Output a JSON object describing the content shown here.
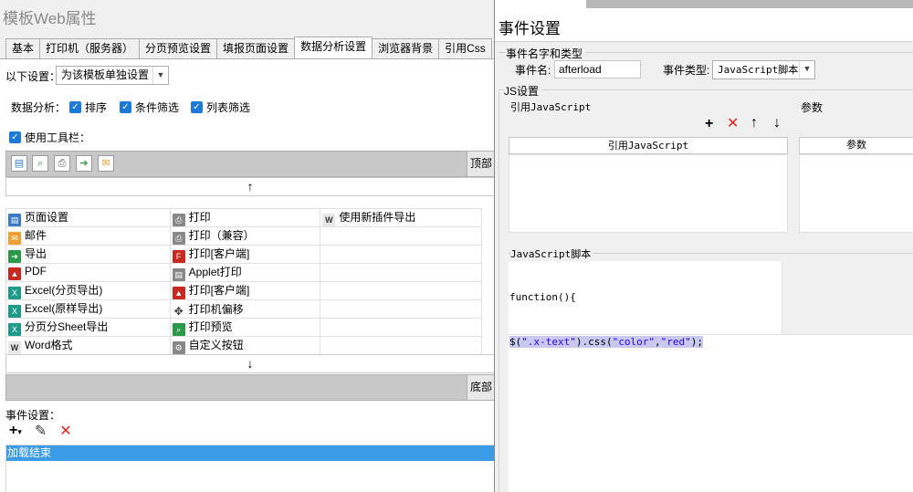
{
  "main": {
    "title": "模板Web属性",
    "tabs": [
      "基本",
      "打印机（服务器）",
      "分页预览设置",
      "填报页面设置",
      "数据分析设置",
      "浏览器背景",
      "引用Css"
    ],
    "active_tab": 4,
    "settings_label": "以下设置：",
    "settings_select": "为该模板单独设置",
    "data_analysis_label": "数据分析：",
    "checkbox_sort": "排序",
    "checkbox_filter": "条件筛选",
    "checkbox_col_filter": "列表筛选",
    "use_toolbar": "使用工具栏：",
    "top_label": "顶部",
    "bottom_label": "底部",
    "up_arrow": "↑",
    "down_arrow": "↓",
    "grid": [
      [
        {
          "icon": "page",
          "text": "页面设置"
        },
        {
          "icon": "print",
          "text": "打印"
        },
        {
          "icon": "word",
          "text": "使用新插件导出"
        }
      ],
      [
        {
          "icon": "mail",
          "text": "邮件"
        },
        {
          "icon": "print",
          "text": "打印（兼容）"
        },
        {
          "icon": "",
          "text": ""
        }
      ],
      [
        {
          "icon": "export",
          "text": "导出"
        },
        {
          "icon": "flash",
          "text": "打印[客户端]"
        },
        {
          "icon": "",
          "text": ""
        }
      ],
      [
        {
          "icon": "pdf",
          "text": "PDF"
        },
        {
          "icon": "applet",
          "text": "Applet打印"
        },
        {
          "icon": "",
          "text": ""
        }
      ],
      [
        {
          "icon": "excel",
          "text": "Excel(分页导出)"
        },
        {
          "icon": "pdfprint",
          "text": "打印[客户端]"
        },
        {
          "icon": "",
          "text": ""
        }
      ],
      [
        {
          "icon": "excel",
          "text": "Excel(原样导出)"
        },
        {
          "icon": "move",
          "text": "打印机偏移"
        },
        {
          "icon": "",
          "text": ""
        }
      ],
      [
        {
          "icon": "excel",
          "text": "分页分Sheet导出"
        },
        {
          "icon": "preview",
          "text": "打印预览"
        },
        {
          "icon": "",
          "text": ""
        }
      ],
      [
        {
          "icon": "word",
          "text": "Word格式"
        },
        {
          "icon": "gear",
          "text": "自定义按钮"
        },
        {
          "icon": "",
          "text": ""
        }
      ]
    ],
    "event_settings_label": "事件设置：",
    "event_item": "加载结束"
  },
  "dialog": {
    "title": "事件设置",
    "section_name_type": "事件名字和类型",
    "event_name_label": "事件名:",
    "event_name_value": "afterload",
    "event_type_label": "事件类型:",
    "event_type_value": "JavaScript脚本",
    "section_js": "JS设置",
    "ref_js_label": "引用JavaScript",
    "params_label": "参数",
    "ref_js_col": "引用JavaScript",
    "params_col": "参数",
    "js_script_label": "JavaScript脚本",
    "code_line1": "function(){",
    "code_line2_prefix": "$(",
    "code_line2_str1": "\".x-text\"",
    "code_line2_mid": ").css(",
    "code_line2_str2": "\"color\"",
    "code_line2_comma": ",",
    "code_line2_str3": "\"red\"",
    "code_line2_end": ");"
  }
}
